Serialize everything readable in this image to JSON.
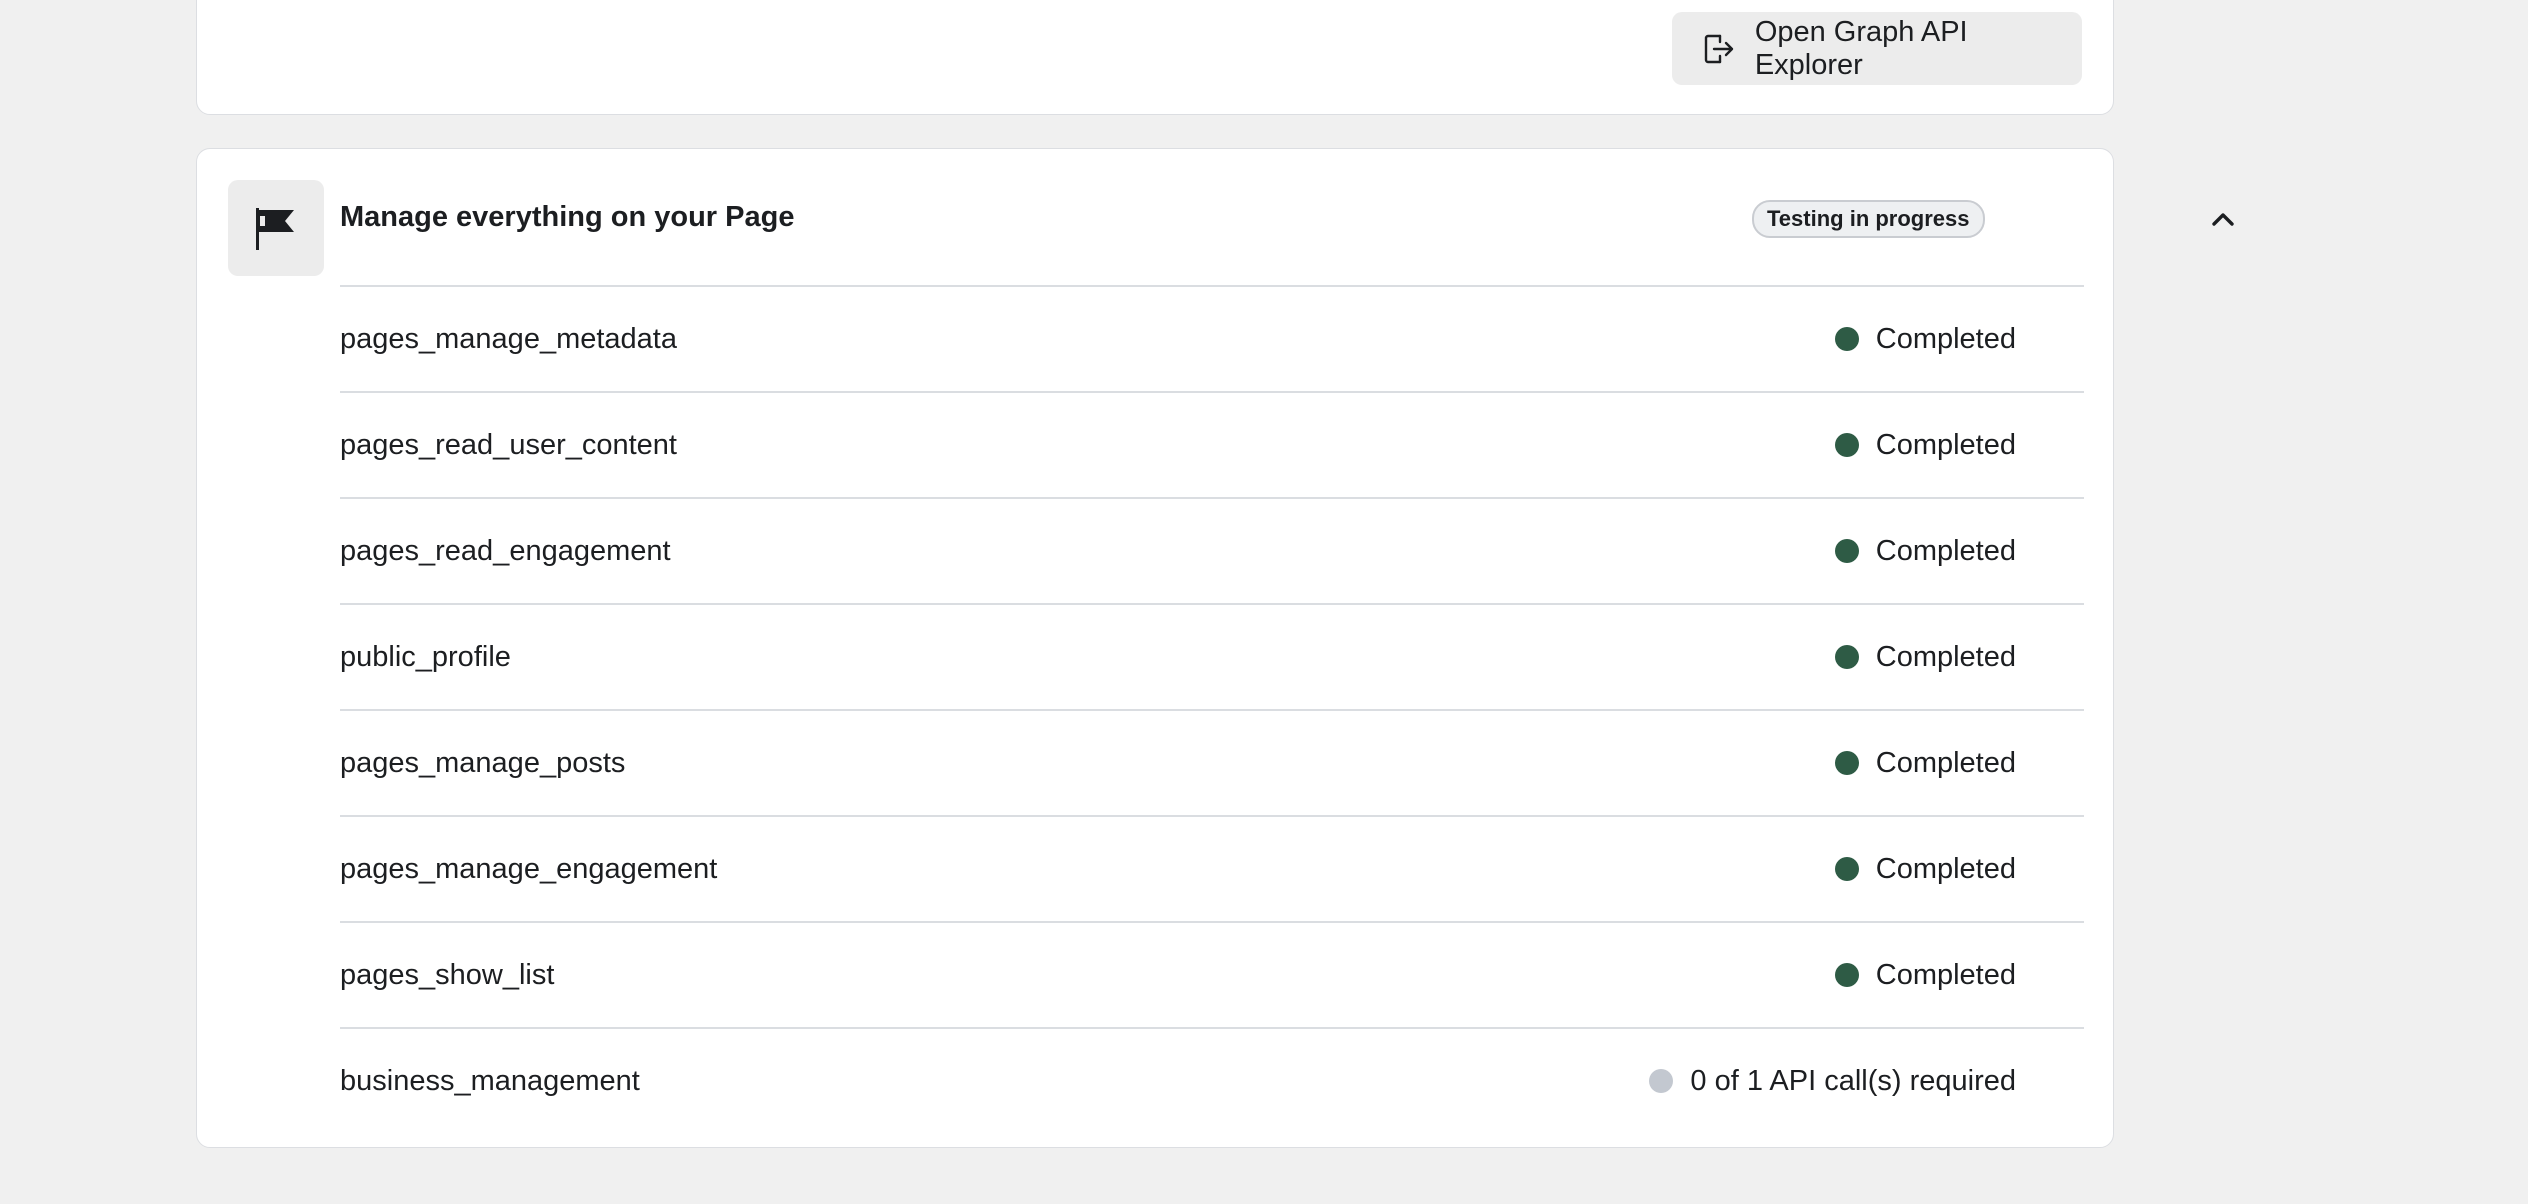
{
  "top_card": {
    "open_explorer_label": "Open Graph API Explorer",
    "open_explorer_icon": "external-open-icon"
  },
  "use_case": {
    "icon": "flag-icon",
    "title": "Manage everything on your Page",
    "badge": "Testing in progress",
    "toggle_icon": "chevron-up-icon",
    "colors": {
      "completed_dot": "#2e5b45",
      "pending_dot": "#c3c8d0"
    },
    "permissions": [
      {
        "name": "pages_manage_metadata",
        "status": "Completed",
        "state": "completed"
      },
      {
        "name": "pages_read_user_content",
        "status": "Completed",
        "state": "completed"
      },
      {
        "name": "pages_read_engagement",
        "status": "Completed",
        "state": "completed"
      },
      {
        "name": "public_profile",
        "status": "Completed",
        "state": "completed"
      },
      {
        "name": "pages_manage_posts",
        "status": "Completed",
        "state": "completed"
      },
      {
        "name": "pages_manage_engagement",
        "status": "Completed",
        "state": "completed"
      },
      {
        "name": "pages_show_list",
        "status": "Completed",
        "state": "completed"
      },
      {
        "name": "business_management",
        "status": "0 of 1 API call(s) required",
        "state": "pending"
      }
    ]
  }
}
